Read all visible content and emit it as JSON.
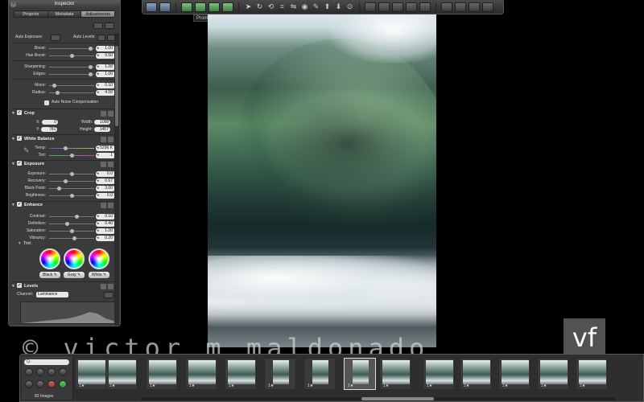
{
  "toolbar": {
    "tooltip": "Promote",
    "tooltip_shortcut": "⌘",
    "tools": [
      "selection-tool-icon",
      "rotate-tool-icon",
      "straighten-tool-icon",
      "crop-tool-icon",
      "flip-tool-icon",
      "red-eye-tool-icon",
      "retouch-tool-icon",
      "lift-tool-icon",
      "stamp-tool-icon",
      "loupe-tool-icon"
    ]
  },
  "inspector": {
    "title": "Inspector",
    "tabs": [
      "Projects",
      "Metadata",
      "Adjustments"
    ],
    "active_tab": "Adjustments",
    "auto_exposure": "Auto Exposure:",
    "auto_levels": "Auto Levels:",
    "sliders_top": [
      {
        "label": "Boost:",
        "value": "1.00"
      },
      {
        "label": "Hue Boost:",
        "value": "0.50"
      },
      {
        "label": "Sharpening:",
        "value": "1.00"
      },
      {
        "label": "Edges:",
        "value": "1.00"
      },
      {
        "label": "Moire:",
        "value": "0.10"
      },
      {
        "label": "Radius:",
        "value": "4.00"
      }
    ],
    "auto_noise": "Auto Noise Compensation",
    "crop": {
      "title": "Crop",
      "x_label": "X:",
      "x": "0",
      "y_label": "Y:",
      "y": "781",
      "width_label": "Width:",
      "width": "1098",
      "height_label": "Height:",
      "height": "1457"
    },
    "white_balance": {
      "title": "White Balance",
      "temp_label": "Temp:",
      "temp": "5296 K",
      "tint_label": "Tint:",
      "tint": "1"
    },
    "exposure": {
      "title": "Exposure",
      "rows": [
        {
          "label": "Exposure:",
          "value": "0.0"
        },
        {
          "label": "Recovery:",
          "value": "0.67"
        },
        {
          "label": "Black Point:",
          "value": "3.00"
        },
        {
          "label": "Brightness:",
          "value": "0.0"
        }
      ]
    },
    "enhance": {
      "title": "Enhance",
      "rows": [
        {
          "label": "Contrast:",
          "value": "0.10"
        },
        {
          "label": "Definition:",
          "value": "0.40"
        },
        {
          "label": "Saturation:",
          "value": "1.00"
        },
        {
          "label": "Vibrancy:",
          "value": "0.20"
        }
      ],
      "tint_label": "Tint:",
      "wheels": [
        "Black",
        "Gray",
        "White"
      ]
    },
    "levels": {
      "title": "Levels",
      "channel_label": "Channel:",
      "channel": "Luminance"
    }
  },
  "watermark": "© victor m maldonado",
  "logo": "vf",
  "filmstrip": {
    "search_placeholder": "Q-",
    "image_count": "82 Images",
    "thumbs": [
      {
        "meta": "1★"
      },
      {
        "meta": "1★"
      },
      {
        "meta": "1★"
      },
      {
        "meta": "1★"
      },
      {
        "meta": "1★"
      },
      {
        "meta": "1★"
      },
      {
        "meta": "1★"
      },
      {
        "meta": "1★"
      },
      {
        "meta": "1★"
      },
      {
        "meta": "1★"
      },
      {
        "meta": "1★"
      },
      {
        "meta": "1★"
      },
      {
        "meta": "1★"
      },
      {
        "meta": "1★"
      }
    ]
  }
}
